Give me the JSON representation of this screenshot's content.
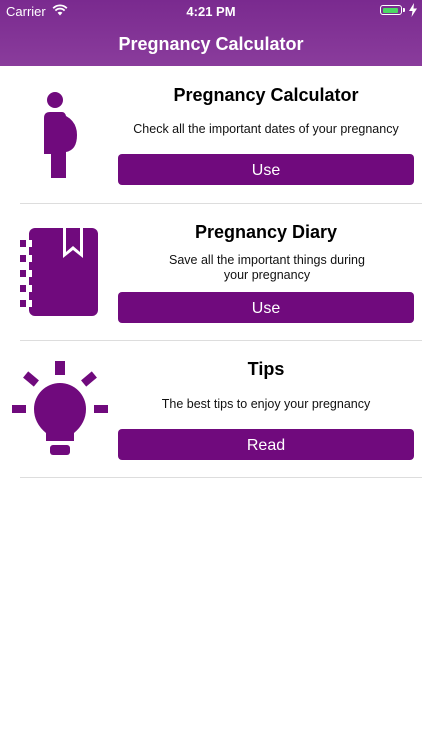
{
  "status_bar": {
    "carrier": "Carrier",
    "time": "4:21 PM"
  },
  "nav": {
    "title": "Pregnancy Calculator"
  },
  "theme": {
    "accent": "#700a7d",
    "nav_bg": "#7a2a8f",
    "battery": "#4cd964"
  },
  "cards": [
    {
      "icon": "pregnant-woman-icon",
      "title": "Pregnancy Calculator",
      "description": "Check all the important dates of your pregnancy",
      "button": "Use"
    },
    {
      "icon": "diary-icon",
      "title": "Pregnancy Diary",
      "description": "Save all the important things during your pregnancy",
      "button": "Use"
    },
    {
      "icon": "lightbulb-icon",
      "title": "Tips",
      "description": "The best tips to enjoy your pregnancy",
      "button": "Read"
    }
  ]
}
